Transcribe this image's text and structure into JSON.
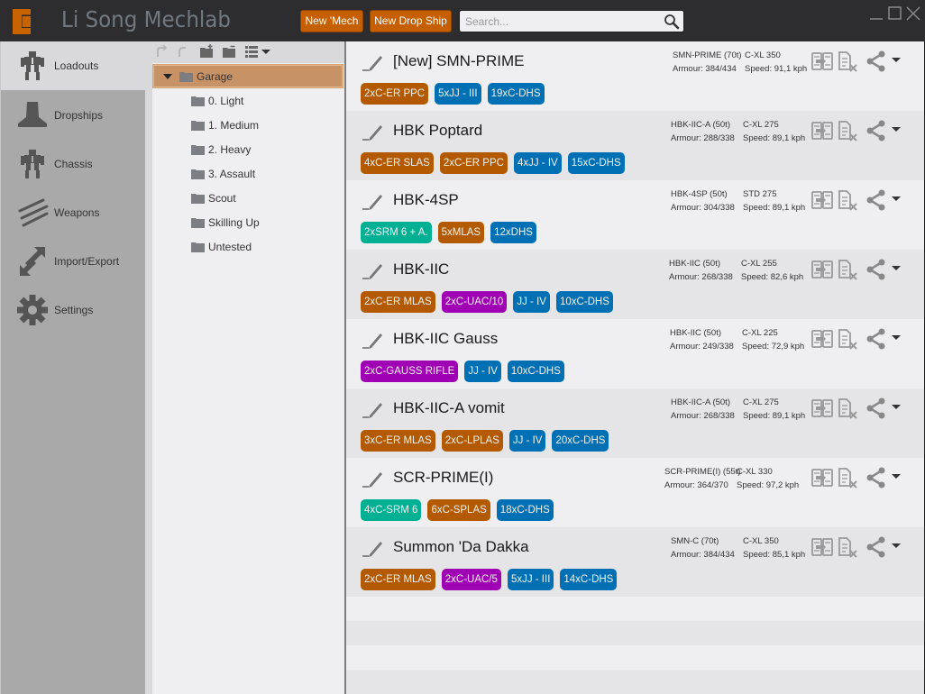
{
  "app": {
    "title": "Li Song Mechlab",
    "new_mech_label": "New 'Mech",
    "new_dropship_label": "New Drop Ship",
    "search_placeholder": "Search...",
    "search_value": ""
  },
  "colors": {
    "accent": "#c65f00",
    "tag_energy": "#b35a00",
    "tag_ballistic": "#a000b4",
    "tag_equipment": "#0070b5",
    "tag_missile": "#00b092",
    "tree_selected": "#c79266"
  },
  "sidebar": {
    "items": [
      {
        "label": "Loadouts",
        "icon": "mech-icon",
        "active": true
      },
      {
        "label": "Dropships",
        "icon": "dropship-icon",
        "active": false
      },
      {
        "label": "Chassis",
        "icon": "chassis-icon",
        "active": false
      },
      {
        "label": "Weapons",
        "icon": "weapons-icon",
        "active": false
      },
      {
        "label": "Import/Export",
        "icon": "import-export-icon",
        "active": false
      },
      {
        "label": "Settings",
        "icon": "gear-icon",
        "active": false
      }
    ]
  },
  "tree": {
    "toolbar": [
      "undo-icon",
      "redo-icon",
      "new-folder-icon",
      "remove-folder-icon",
      "list-view-icon"
    ],
    "root": {
      "label": "Garage",
      "expanded": true,
      "selected": true
    },
    "children": [
      {
        "label": "0. Light"
      },
      {
        "label": "1. Medium"
      },
      {
        "label": "2. Heavy"
      },
      {
        "label": "3. Assault"
      },
      {
        "label": "Scout"
      },
      {
        "label": "Skilling Up"
      },
      {
        "label": "Untested"
      }
    ]
  },
  "loadouts": [
    {
      "name": "[New] SMN-PRIME",
      "chassis": "SMN-PRIME (70t)",
      "engine": "C-XL 350",
      "armour": "Armour: 384/434",
      "speed": "Speed: 91,1 kph",
      "tags": [
        {
          "label": "2xC-ER PPC",
          "type": "energy"
        },
        {
          "label": "5xJJ - III",
          "type": "equipment"
        },
        {
          "label": "19xC-DHS",
          "type": "equipment"
        }
      ]
    },
    {
      "name": "HBK Poptard",
      "chassis": "HBK-IIC-A (50t)",
      "engine": "C-XL 275",
      "armour": "Armour: 288/338",
      "speed": "Speed: 89,1 kph",
      "tags": [
        {
          "label": "4xC-ER SLAS",
          "type": "energy"
        },
        {
          "label": "2xC-ER PPC",
          "type": "energy"
        },
        {
          "label": "4xJJ - IV",
          "type": "equipment"
        },
        {
          "label": "15xC-DHS",
          "type": "equipment"
        }
      ]
    },
    {
      "name": "HBK-4SP",
      "chassis": "HBK-4SP (50t)",
      "engine": "STD 275",
      "armour": "Armour: 304/338",
      "speed": "Speed: 89,1 kph",
      "tags": [
        {
          "label": "2xSRM 6 + A.",
          "type": "missile"
        },
        {
          "label": "5xMLAS",
          "type": "energy"
        },
        {
          "label": "12xDHS",
          "type": "equipment"
        }
      ]
    },
    {
      "name": "HBK-IIC",
      "chassis": "HBK-IIC (50t)",
      "engine": "C-XL 255",
      "armour": "Armour: 268/338",
      "speed": "Speed: 82,6 kph",
      "tags": [
        {
          "label": "2xC-ER MLAS",
          "type": "energy"
        },
        {
          "label": "2xC-UAC/10",
          "type": "ballistic"
        },
        {
          "label": "JJ - IV",
          "type": "equipment"
        },
        {
          "label": "10xC-DHS",
          "type": "equipment"
        }
      ]
    },
    {
      "name": "HBK-IIC Gauss",
      "chassis": "HBK-IIC (50t)",
      "engine": "C-XL 225",
      "armour": "Armour: 249/338",
      "speed": "Speed: 72,9 kph",
      "tags": [
        {
          "label": "2xC-GAUSS RIFLE",
          "type": "ballistic"
        },
        {
          "label": "JJ - IV",
          "type": "equipment"
        },
        {
          "label": "10xC-DHS",
          "type": "equipment"
        }
      ]
    },
    {
      "name": "HBK-IIC-A vomit",
      "chassis": "HBK-IIC-A (50t)",
      "engine": "C-XL 275",
      "armour": "Armour: 268/338",
      "speed": "Speed: 89,1 kph",
      "tags": [
        {
          "label": "3xC-ER MLAS",
          "type": "energy"
        },
        {
          "label": "2xC-LPLAS",
          "type": "energy"
        },
        {
          "label": "JJ - IV",
          "type": "equipment"
        },
        {
          "label": "20xC-DHS",
          "type": "equipment"
        }
      ]
    },
    {
      "name": "SCR-PRIME(I)",
      "chassis": "SCR-PRIME(I) (55t)",
      "engine": "C-XL 330",
      "armour": "Armour: 364/370",
      "speed": "Speed: 97,2 kph",
      "tags": [
        {
          "label": "4xC-SRM 6",
          "type": "missile"
        },
        {
          "label": "6xC-SPLAS",
          "type": "energy"
        },
        {
          "label": "18xC-DHS",
          "type": "equipment"
        }
      ]
    },
    {
      "name": "Summon 'Da Dakka",
      "chassis": "SMN-C (70t)",
      "engine": "C-XL 350",
      "armour": "Armour: 384/434",
      "speed": "Speed: 85,1 kph",
      "tags": [
        {
          "label": "2xC-ER MLAS",
          "type": "energy"
        },
        {
          "label": "2xC-UAC/5",
          "type": "ballistic"
        },
        {
          "label": "5xJJ - III",
          "type": "equipment"
        },
        {
          "label": "14xC-DHS",
          "type": "equipment"
        }
      ]
    }
  ]
}
